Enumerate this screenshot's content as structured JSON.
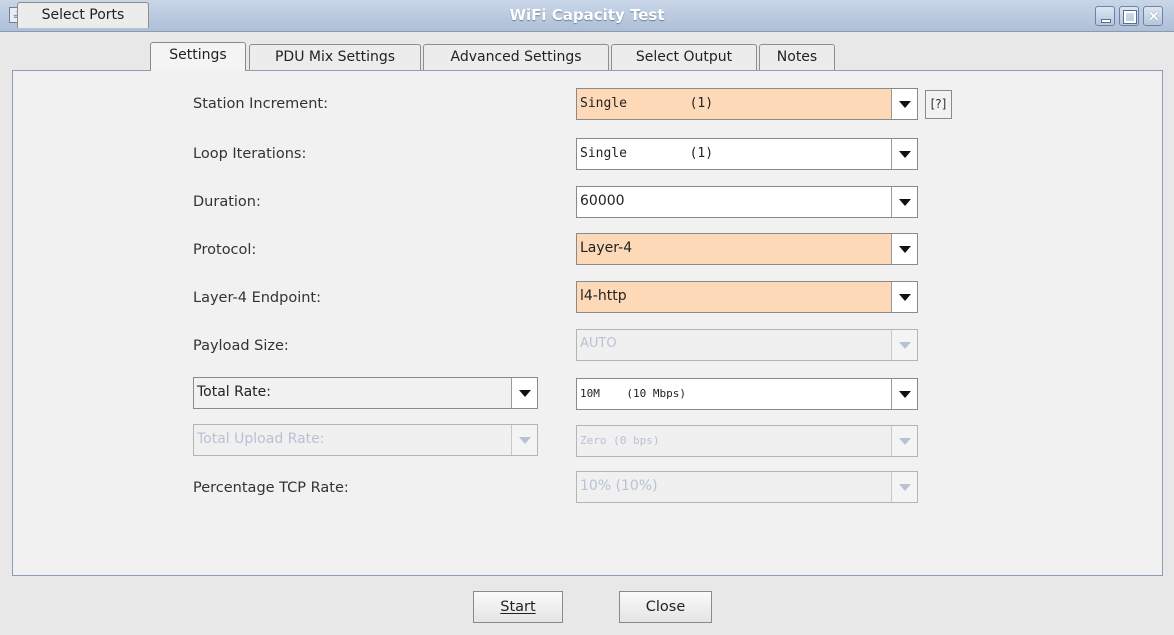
{
  "window": {
    "title": "WiFi Capacity Test",
    "icon": "java-cup-icon",
    "controls": [
      "minimize-icon",
      "maximize-icon",
      "close-icon"
    ]
  },
  "tabs": [
    {
      "label": "Select Ports",
      "active": false
    },
    {
      "label": "Settings",
      "active": true
    },
    {
      "label": "PDU Mix Settings",
      "active": false
    },
    {
      "label": "Advanced Settings",
      "active": false
    },
    {
      "label": "Select Output",
      "active": false
    },
    {
      "label": "Notes",
      "active": false
    }
  ],
  "settings": {
    "station_increment": {
      "label": "Station Increment:",
      "value": "Single        (1)"
    },
    "help_label": "[?]",
    "loop_iterations": {
      "label": "Loop Iterations:",
      "value": "Single        (1)"
    },
    "duration": {
      "label": "Duration:",
      "value": "60000"
    },
    "protocol": {
      "label": "Protocol:",
      "value": "Layer-4"
    },
    "layer4_endpoint": {
      "label": "Layer-4 Endpoint:",
      "value": "l4-http"
    },
    "payload_size": {
      "label": "Payload Size:",
      "value": "AUTO"
    },
    "total_rate": {
      "selector": "Total Rate:",
      "value": "10M    (10 Mbps)"
    },
    "total_upload_rate": {
      "selector": "Total Upload Rate:",
      "value": "Zero (0 bps)"
    },
    "percentage_tcp_rate": {
      "label": "Percentage TCP Rate:",
      "value": "10% (10%)"
    }
  },
  "buttons": {
    "start": "Start",
    "close": "Close"
  },
  "colors": {
    "highlight_field": "#fdd9b7",
    "titlebar": "#aebfd6"
  }
}
